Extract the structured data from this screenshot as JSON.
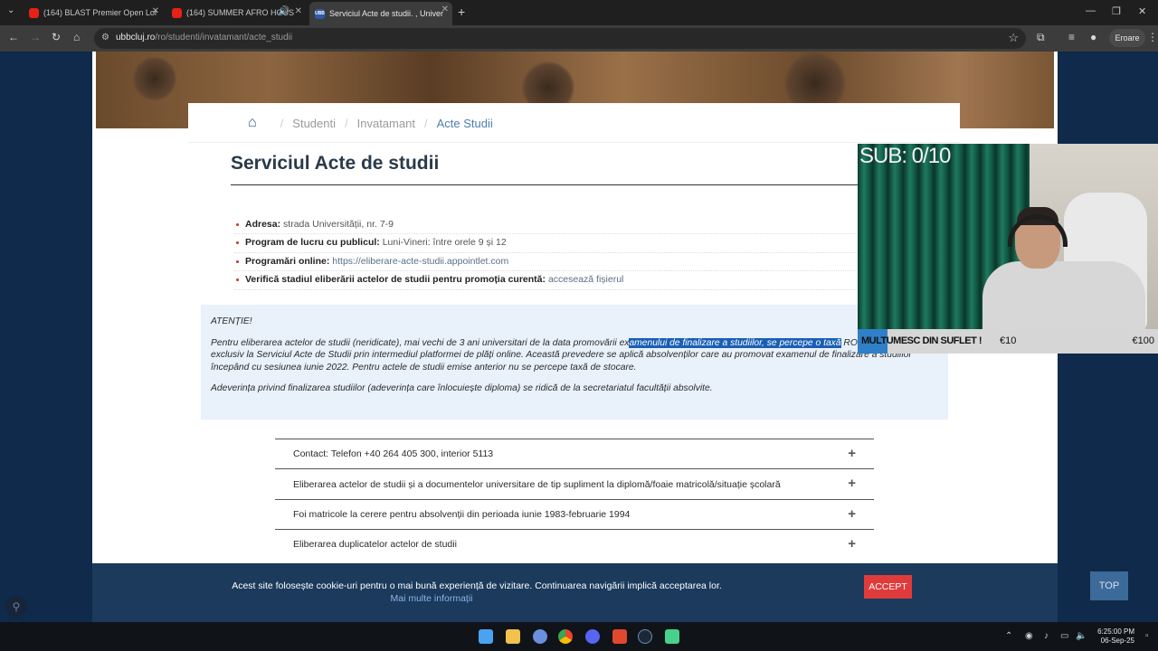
{
  "browser": {
    "tabs": [
      {
        "title": "(164) BLAST Premier Open Lon"
      },
      {
        "title": "(164) SUMMER AFRO HOUS"
      },
      {
        "title": "Serviciul Acte de studii. , Univer",
        "favicon": "UBB"
      }
    ],
    "url_domain": "ubbcluj.ro",
    "url_path": "/ro/studenti/invatamant/acte_studii",
    "profile_status": "Eroare"
  },
  "breadcrumb": [
    "Studenti",
    "Invatamant",
    "Acte Studii"
  ],
  "page": {
    "title": "Serviciul Acte de studii",
    "info": [
      {
        "label": "Adresa:",
        "value": "strada Universității, nr. 7-9"
      },
      {
        "label": "Program de lucru cu publicul:",
        "value": "Luni-Vineri: între orele 9 și 12"
      },
      {
        "label": "Programări online:",
        "value": "https://eliberare-acte-studii.appointlet.com"
      },
      {
        "label": "Verifică stadiul eliberării actelor de studii pentru promoția curentă:",
        "value": "accesează fișierul"
      }
    ],
    "alert": {
      "heading": "ATENȚIE!",
      "p1_before": "Pentru eliberarea actelor de studii (neridicate), mai vechi de 3 ani universitari de la data promovării ex",
      "p1_highlight": "amenului de finalizare a studiilor, se percepe o taxă",
      "p1_after": " RON. Taxa se achită exclusiv la Serviciul Acte de Studii prin intermediul platformei de plăți online. Această prevedere se aplică absolvenților care au promovat examenul de finalizare a studiilor începând cu sesiunea iunie 2022. Pentru actele de studii emise anterior nu se percepe taxă de stocare.",
      "p2": "Adeverința privind finalizarea studiilor (adeverința care înlocuiește diploma) se ridică de la secretariatul facultății absolvite."
    },
    "accordion": [
      "Contact: Telefon +40 264 405 300, interior 5113",
      "Eliberarea actelor de studii și a documentelor universitare de tip supliment la diplomă/foaie matricolă/situație școlară",
      "Foi matricole la cerere pentru absolvenții din perioada iunie 1983-februarie 1994",
      "Eliberarea duplicatelor actelor de studii"
    ]
  },
  "cookie": {
    "message": "Acest site folosește cookie-uri pentru o mai bună experiență de vizitare. Continuarea navigării implică acceptarea lor.",
    "more": "Mai multe informații",
    "accept": "ACCEPT"
  },
  "top_button": "TOP",
  "stream": {
    "sub_counter": "SUB: 0/10",
    "goal_label": "MULTUMESC DIN SUFLET !",
    "current": "€10",
    "goal": "€100",
    "progress_fraction": 0.1
  },
  "taskbar": {
    "time": "6:25:00 PM",
    "date": "06-Sep-25"
  },
  "colors": {
    "accent_link": "#4a7fb0",
    "alert_bg": "#e9f1fb",
    "accept_red": "#e03b3b",
    "cookie_bg": "#1b3a5c"
  }
}
